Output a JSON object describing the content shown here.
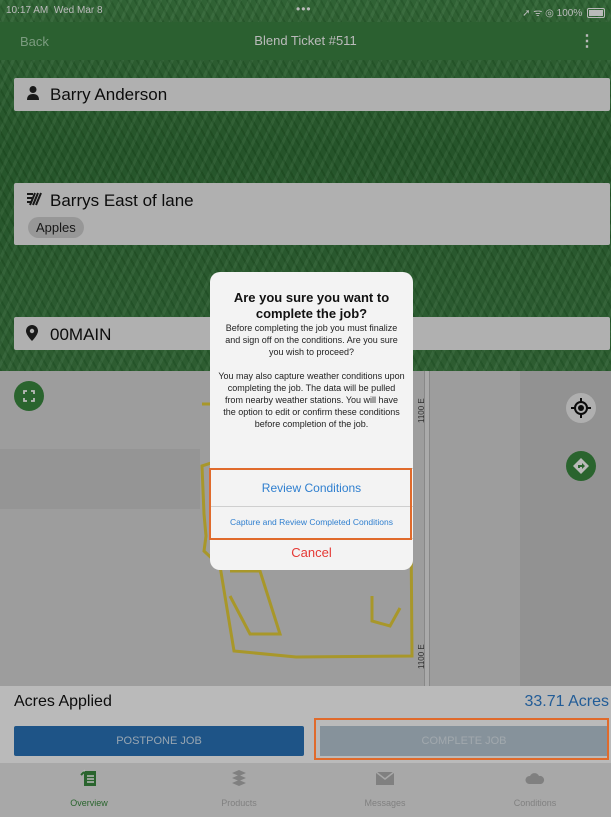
{
  "status_bar": {
    "time": "10:17 AM",
    "date": "Wed Mar 8",
    "dots": "•••",
    "signal": "➚ ᯤ ◎",
    "battery": "100%"
  },
  "nav": {
    "back": "Back",
    "title": "Blend Ticket #511",
    "menu_icon": "more-vertical-icon"
  },
  "fields": {
    "customer": "Barry Anderson",
    "field_name": "Barrys East of lane",
    "crop_tag": "Apples",
    "location": "00MAIN"
  },
  "map": {
    "road_label_top": "1100 E",
    "road_label_bottom": "1100 E"
  },
  "footer": {
    "acres_label": "Acres Applied",
    "acres_value": "33.71 Acres",
    "postpone": "POSTPONE JOB",
    "complete": "COMPLETE JOB"
  },
  "tabs": [
    {
      "label": "Overview",
      "icon": "overview-icon",
      "color": "#3a8a3f"
    },
    {
      "label": "Products",
      "icon": "products-icon",
      "color": "#b0b0b0"
    },
    {
      "label": "Messages",
      "icon": "messages-icon",
      "color": "#b0b0b0"
    },
    {
      "label": "Conditions",
      "icon": "conditions-icon",
      "color": "#b0b0b0"
    }
  ],
  "alert": {
    "title": "Are you sure you want to complete the job?",
    "message": "Before completing the job you must finalize and sign off on the conditions. Are you sure you wish to proceed?\n\nYou may also capture weather conditions upon completing the job. The data will be pulled from nearby weather stations.  You will have the option to edit or confirm these conditions before completion of the job.",
    "action_review": "Review Conditions",
    "action_capture": "Capture and Review Completed Conditions",
    "action_cancel": "Cancel"
  },
  "colors": {
    "brand_green": "#3b8442",
    "link_blue": "#2f7fcf",
    "cancel_red": "#e53935",
    "highlight_orange": "#e06a2b"
  }
}
